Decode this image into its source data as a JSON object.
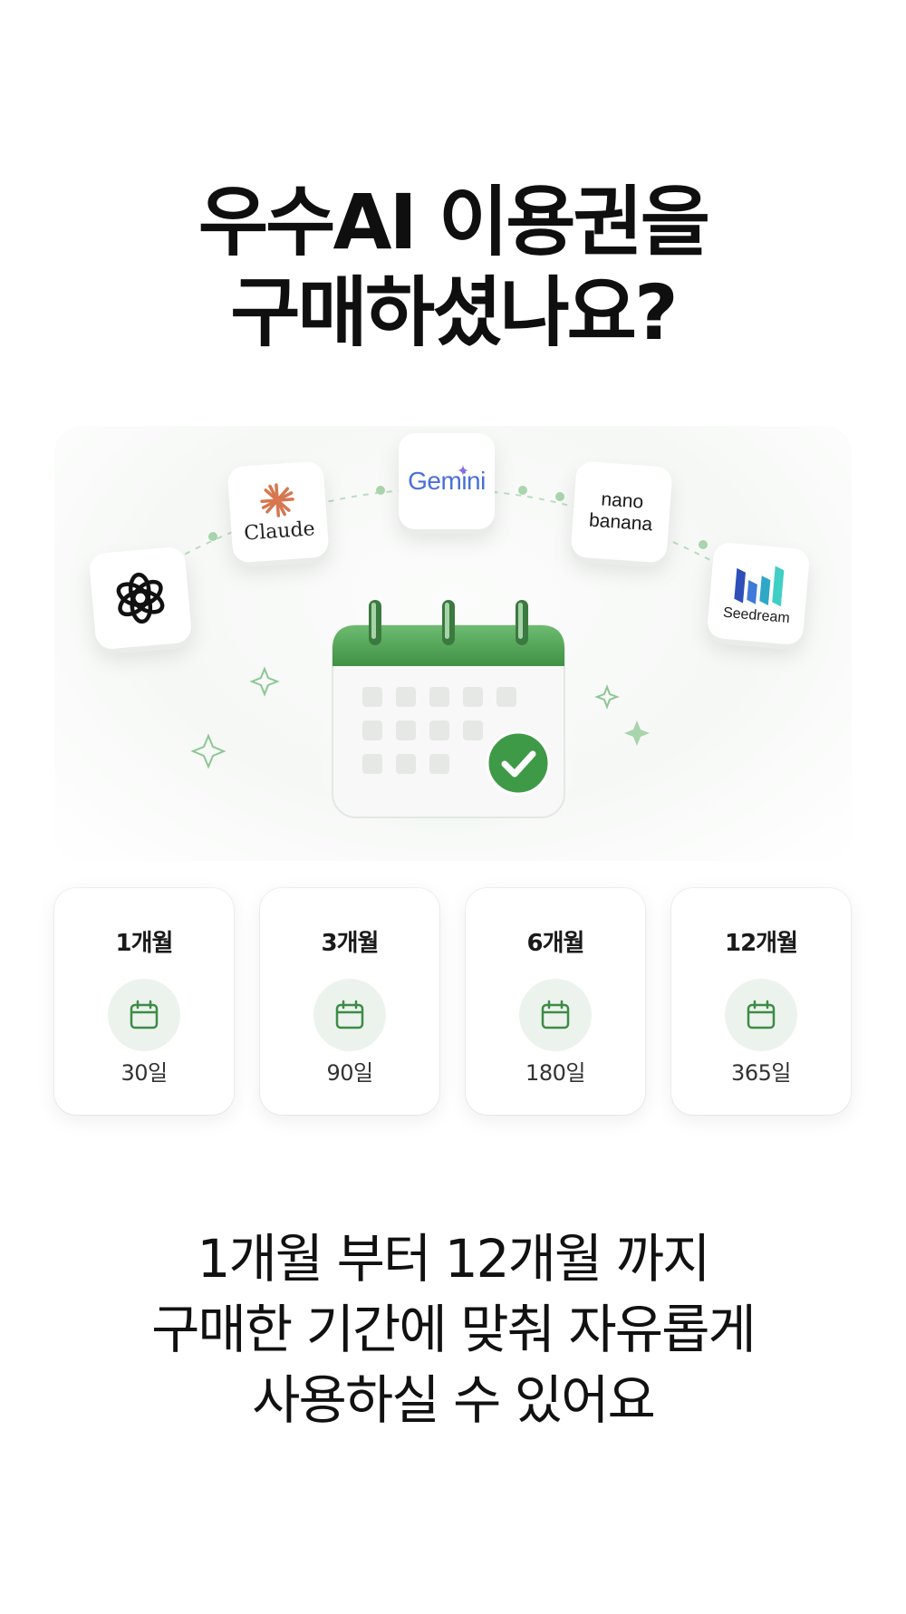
{
  "headline": {
    "line1": "우수AI 이용권을",
    "line2": "구매하셨나요?"
  },
  "ai_tools": [
    {
      "name": "OpenAI",
      "icon": "openai-logo-icon"
    },
    {
      "name": "Claude",
      "icon": "claude-logo-icon"
    },
    {
      "name": "Gemini",
      "icon": "gemini-logo-icon"
    },
    {
      "name": "nano banana",
      "line1": "nano",
      "line2": "banana"
    },
    {
      "name": "Seedream",
      "icon": "seedream-logo-icon"
    }
  ],
  "hero_icon": "calendar-check-icon",
  "plans": [
    {
      "title": "1개월",
      "days": "30일",
      "icon": "calendar-icon"
    },
    {
      "title": "3개월",
      "days": "90일",
      "icon": "calendar-icon"
    },
    {
      "title": "6개월",
      "days": "180일",
      "icon": "calendar-icon"
    },
    {
      "title": "12개월",
      "days": "365일",
      "icon": "calendar-icon"
    }
  ],
  "body": {
    "line1": "1개월 부터 12개월 까지",
    "line2": "구매한 기간에 맞춰 자유롭게",
    "line3": "사용하실 수 있어요"
  },
  "colors": {
    "accent_green": "#4caf50",
    "dark_green": "#3d8b46",
    "icon_bg": "#ecf3ed"
  }
}
